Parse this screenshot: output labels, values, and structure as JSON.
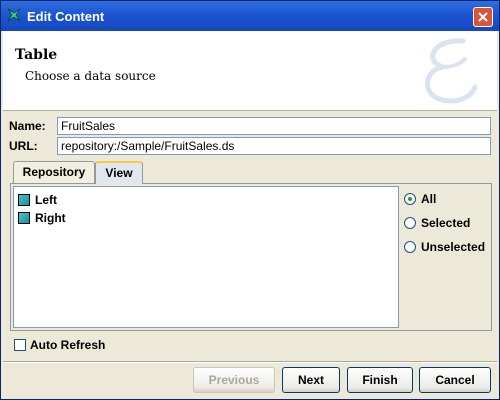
{
  "window": {
    "title": "Edit Content"
  },
  "header": {
    "title": "Table",
    "subtitle": "Choose a data source"
  },
  "fields": {
    "name_label": "Name:",
    "name_value": "FruitSales",
    "url_label": "URL:",
    "url_value": "repository:/Sample/FruitSales.ds"
  },
  "tabs": [
    {
      "label": "Repository",
      "active": false
    },
    {
      "label": "View",
      "active": true
    }
  ],
  "view_list": [
    {
      "label": "Left",
      "icon": "table-icon"
    },
    {
      "label": "Right",
      "icon": "table-icon"
    }
  ],
  "filter": {
    "options": [
      {
        "label": "All",
        "selected": true
      },
      {
        "label": "Selected",
        "selected": false
      },
      {
        "label": "Unselected",
        "selected": false
      }
    ]
  },
  "auto_refresh": {
    "label": "Auto Refresh",
    "checked": false
  },
  "buttons": {
    "previous": "Previous",
    "next": "Next",
    "finish": "Finish",
    "cancel": "Cancel"
  },
  "colors": {
    "titlebar": "#1c56d0",
    "accent": "#ffc83c",
    "close": "#d9553a"
  }
}
